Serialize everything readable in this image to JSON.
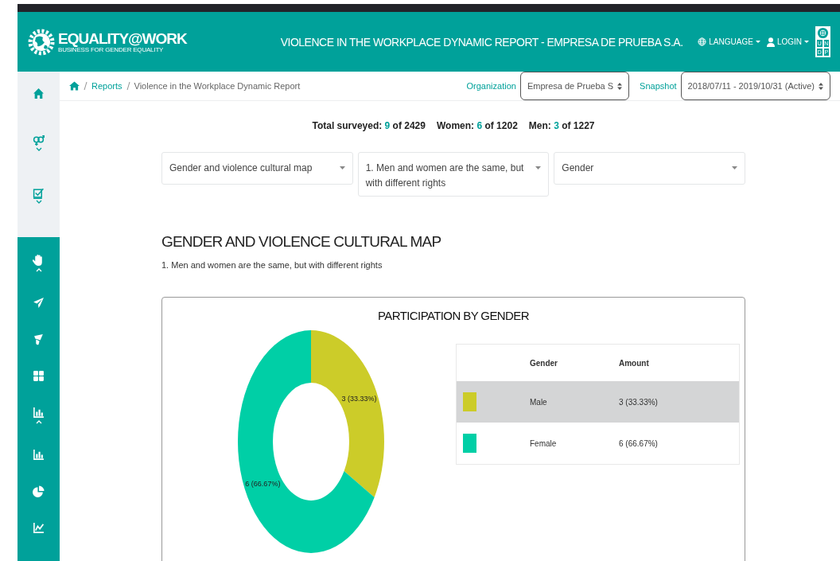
{
  "header": {
    "brand": "EQUALITY@WORK",
    "tagline": "BUSINESS FOR GENDER EQUALITY",
    "title": "VIOLENCE IN THE WORKPLACE DYNAMIC REPORT - EMPRESA DE PRUEBA S.A.",
    "language": "LANGUAGE",
    "login": "LOGIN",
    "undp_letters": [
      "U",
      "N",
      "D",
      "P"
    ]
  },
  "sidebar": {
    "top_items": [
      {
        "kind": "home"
      },
      {
        "kind": "gender",
        "expanded": false
      },
      {
        "kind": "checklist",
        "expanded": false
      }
    ],
    "bottom_items": [
      {
        "kind": "hand",
        "expanded": true
      },
      {
        "kind": "plane"
      },
      {
        "kind": "megaphone"
      },
      {
        "kind": "grid"
      },
      {
        "kind": "bars",
        "expanded": true
      },
      {
        "kind": "bars"
      },
      {
        "kind": "pie"
      },
      {
        "kind": "line"
      }
    ]
  },
  "breadcrumb": [
    {
      "label": "Reports",
      "link": true
    },
    {
      "label": "Violence in the Workplace Dynamic Report",
      "link": false
    }
  ],
  "organization": {
    "label": "Organization",
    "value": "Empresa de Prueba S"
  },
  "snapshot": {
    "label": "Snapshot",
    "value": "2018/07/11 - 2019/10/31 (Active)"
  },
  "stats": [
    {
      "label": "Total surveyed:",
      "count": "9",
      "total": "of 2429"
    },
    {
      "label": "Women:",
      "count": "6",
      "total": "of 1202"
    },
    {
      "label": "Men:",
      "count": "3",
      "total": "of 1227"
    }
  ],
  "filters": [
    "Gender and violence cultural map",
    "1. Men and women are the same, but with different rights",
    "Gender"
  ],
  "section": {
    "title": "GENDER AND VIOLENCE CULTURAL MAP",
    "subtitle": "1. Men and women are the same, but with different rights"
  },
  "chart_card": {
    "title": "PARTICIPATION BY GENDER",
    "chart_data": {
      "type": "donut",
      "values": [
        3,
        6
      ],
      "colors": [
        "#cccc29",
        "#00cfa6"
      ],
      "value_labels": [
        "3 (33.33%)",
        "6 (66.67%)"
      ]
    },
    "legend": {
      "columns": [
        "Gender",
        "Amount"
      ],
      "rows": [
        {
          "color": "#cccc29",
          "gender": "Male",
          "amount": "3 (33.33%)",
          "highlighted": true
        },
        {
          "color": "#00cfa6",
          "gender": "Female",
          "amount": "6 (66.67%)",
          "highlighted": false
        }
      ]
    }
  }
}
